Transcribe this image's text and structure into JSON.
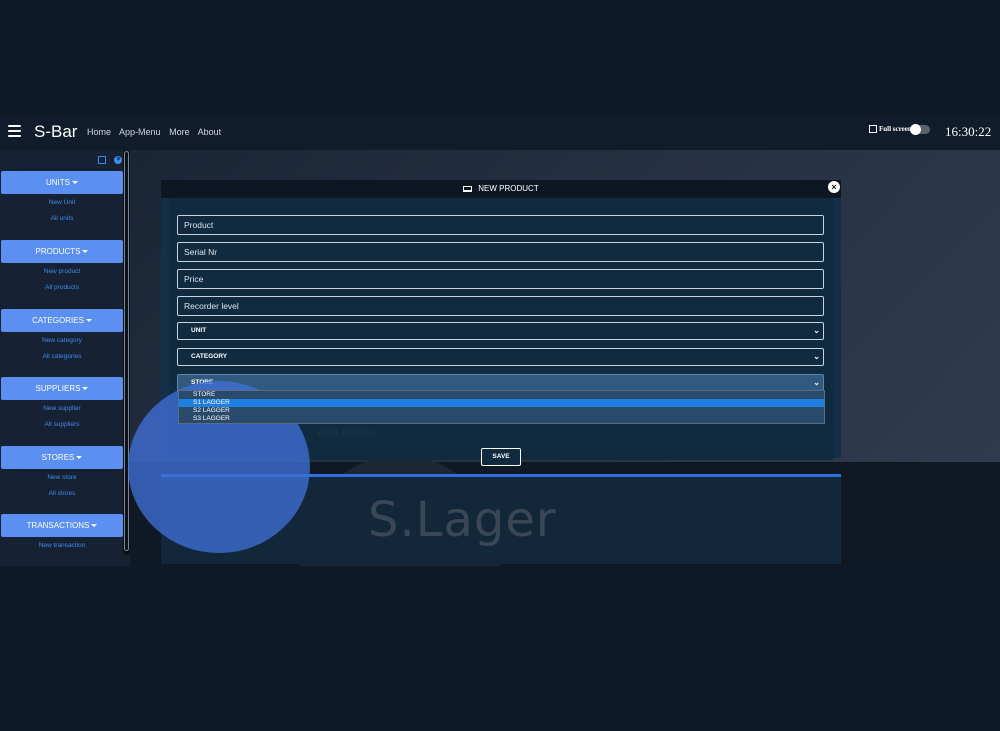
{
  "topbar": {
    "brand": "S-Bar",
    "nav": [
      "Home",
      "App-Menu",
      "More",
      "About"
    ],
    "fullscreen_label": "Full screen",
    "clock": "16:30:22"
  },
  "sidebar": {
    "sections": [
      {
        "label": "UNITS",
        "links": [
          "New Unit",
          "All units"
        ]
      },
      {
        "label": "PRODUCTS",
        "links": [
          "New product",
          "All products"
        ]
      },
      {
        "label": "CATEGORIES",
        "links": [
          "New category",
          "All categories"
        ]
      },
      {
        "label": "SUPPLIERS",
        "links": [
          "New supplier",
          "All suppliers"
        ]
      },
      {
        "label": "STORES",
        "links": [
          "New store",
          "All stores"
        ]
      },
      {
        "label": "TRANSACTIONS",
        "links": [
          "New transaction"
        ]
      }
    ]
  },
  "modal": {
    "title": "NEW PRODUCT",
    "fields": {
      "product": "Product",
      "serial": "Serial Nr",
      "price": "Price",
      "recorder": "Recorder level"
    },
    "selects": {
      "unit": "UNIT",
      "category": "CATEGORY",
      "store": "STORE"
    },
    "store_options": [
      "STORE",
      "S1 LAGGER",
      "S2 LAGGER",
      "S3 LAGGER"
    ],
    "save_label": "SAVE"
  },
  "background": {
    "watermark": "S.Lager",
    "watermark_sub": "Web Edition"
  },
  "colors": {
    "accent": "#5b90f2",
    "link": "#3d8cf0",
    "highlight": "#1e7fe0"
  }
}
